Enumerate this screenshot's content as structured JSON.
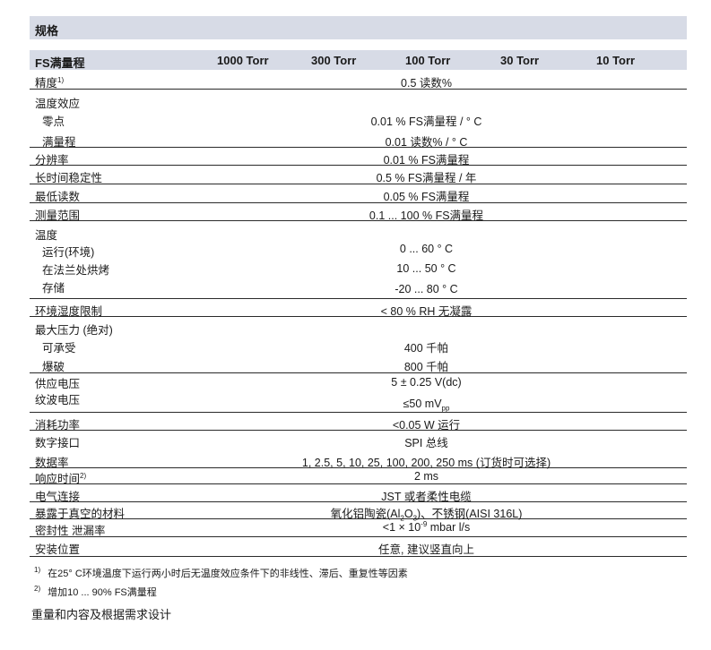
{
  "section_title": "规格",
  "header": {
    "label": "FS满量程",
    "ranges": [
      "1000 Torr",
      "300 Torr",
      "100 Torr",
      "30 Torr",
      "10 Torr"
    ]
  },
  "rows": {
    "accuracy": {
      "label": "精度",
      "mark": "1)",
      "value": "0.5 读数%"
    },
    "temp_effect": {
      "label": "温度效应",
      "zero_label": "零点",
      "zero_value": "0.01 % FS满量程 / ° C",
      "span_label": "满量程",
      "span_value": "0.01 读数% / ° C"
    },
    "resolution": {
      "label": "分辨率",
      "value": "0.01 % FS满量程"
    },
    "stability": {
      "label": "长时间稳定性",
      "value": "0.5 % FS满量程 / 年"
    },
    "min_reading": {
      "label": "最低读数",
      "value": "0.05 % FS满量程"
    },
    "range": {
      "label": "测量范围",
      "value": "0.1 ... 100 % FS满量程"
    },
    "temperature": {
      "label": "温度",
      "op_label": "运行(环境)",
      "op_value": "0 ... 60 ° C",
      "bake_label": "在法兰处烘烤",
      "bake_value": "10 ... 50 ° C",
      "store_label": "存储",
      "store_value": "-20 ... 80 ° C"
    },
    "humidity": {
      "label": "环境湿度限制",
      "value": "< 80 % RH 无凝露"
    },
    "max_pressure": {
      "label": "最大压力 (绝对)",
      "proof_label": "可承受",
      "proof_value": "400 千帕",
      "burst_label": "爆破",
      "burst_value": "800 千帕"
    },
    "supply": {
      "label": "供应电压",
      "value": "5 ± 0.25 V(dc)",
      "ripple_label": "纹波电压",
      "ripple_value": "≤50 mV",
      "ripple_sub": "pp"
    },
    "power": {
      "label": "消耗功率",
      "value": "<0.05 W 运行"
    },
    "digital": {
      "label": "数字接口",
      "value": "SPI 总线"
    },
    "data_rate": {
      "label": "数据率",
      "value": "1, 2.5, 5, 10, 25, 100, 200, 250 ms (订货时可选择)"
    },
    "response": {
      "label": "响应时间",
      "mark": "2)",
      "value": "2 ms"
    },
    "electrical": {
      "label": "电气连接",
      "value": "JST 或者柔性电缆"
    },
    "wetted": {
      "label": "暴露于真空的材料",
      "value_a": "氧化铝陶瓷(Al",
      "sub1": "2",
      "value_b": "O",
      "sub2": "3",
      "value_c": ")、不锈钢(AISI 316L)"
    },
    "leak": {
      "label": "密封性 泄漏率",
      "value_a": "<1 × 10",
      "exp": "-9",
      "value_b": " mbar l/s"
    },
    "mounting": {
      "label": "安装位置",
      "value": "任意, 建议竖直向上"
    }
  },
  "footnotes": [
    {
      "num": "1)",
      "text": "在25° C环境温度下运行两小时后无温度效应条件下的非线性、滞后、重复性等因素"
    },
    {
      "num": "2)",
      "text": "增加10 ... 90% FS满量程"
    }
  ],
  "note": "重量和内容及根据需求设计"
}
